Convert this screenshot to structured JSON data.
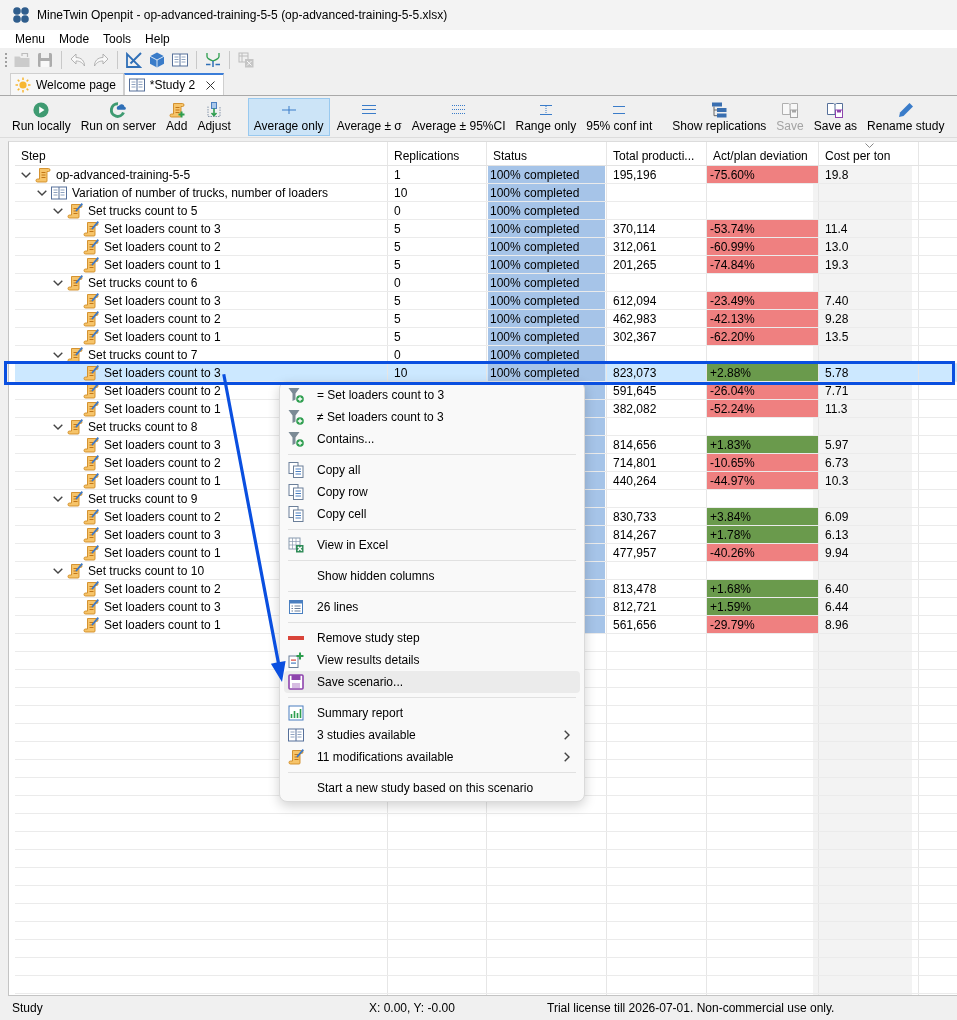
{
  "window": {
    "title": "MineTwin Openpit - op-advanced-training-5-5 (op-advanced-training-5-5.xlsx)"
  },
  "menu_bar": [
    "Menu",
    "Mode",
    "Tools",
    "Help"
  ],
  "icon_toolbar": [
    [
      {
        "kind": "open",
        "disabled": true
      },
      {
        "kind": "save",
        "disabled": true
      }
    ],
    [
      {
        "kind": "undo",
        "disabled": true
      },
      {
        "kind": "redo",
        "disabled": true
      }
    ],
    [
      {
        "kind": "edit",
        "disabled": false
      },
      {
        "kind": "model",
        "disabled": false
      },
      {
        "kind": "study",
        "disabled": false
      }
    ],
    [
      {
        "kind": "merge",
        "disabled": false
      }
    ],
    [
      {
        "kind": "export",
        "disabled": true
      }
    ]
  ],
  "tabs": [
    {
      "label": "Welcome page",
      "kind": "welcome",
      "selected": false,
      "closable": false
    },
    {
      "label": "*Study 2",
      "kind": "study",
      "selected": true,
      "closable": true
    }
  ],
  "study_toolbar": {
    "actions": [
      {
        "label": "Run locally",
        "kind": "run",
        "disabled": false
      },
      {
        "label": "Run on server",
        "kind": "server",
        "disabled": false
      },
      {
        "label": "Add",
        "kind": "add",
        "disabled": false
      },
      {
        "label": "Adjust",
        "kind": "adjust",
        "disabled": false
      }
    ],
    "display_modes": [
      {
        "label": "Average only",
        "kind": "mean",
        "selected": true
      },
      {
        "label": "Average ± σ",
        "kind": "sigma",
        "selected": false
      },
      {
        "label": "Average ± 95%CI",
        "kind": "ci",
        "selected": false
      },
      {
        "label": "Range only",
        "kind": "range",
        "selected": false
      },
      {
        "label": "95% conf int",
        "kind": "conf",
        "selected": false
      }
    ],
    "view_actions": [
      {
        "label": "Show replications",
        "kind": "tree",
        "disabled": false
      },
      {
        "label": "Save",
        "kind": "save",
        "disabled": true
      },
      {
        "label": "Save as",
        "kind": "saveas",
        "disabled": false
      },
      {
        "label": "Rename study",
        "kind": "rename",
        "disabled": false
      }
    ]
  },
  "table": {
    "columns": [
      {
        "label": "Step",
        "sorted": false
      },
      {
        "label": "Replications",
        "sorted": false
      },
      {
        "label": "Status",
        "sorted": false
      },
      {
        "label": "Total producti...",
        "sorted": false
      },
      {
        "label": "Act/plan deviation",
        "sorted": false
      },
      {
        "label": "Cost per ton",
        "sorted": true
      }
    ],
    "rows": [
      {
        "label": "op-advanced-training-5-5",
        "kind": "scenario",
        "selected": false,
        "expanded": true,
        "replications": "1",
        "status": {
          "text": "100% completed",
          "level": 1
        },
        "total_production": "195,196",
        "deviation": {
          "text": "-75.60%",
          "color": "#ef8080"
        },
        "cost": "19.8",
        "children": [
          {
            "label": "Variation of number of trucks, number of loaders",
            "kind": "study",
            "selected": false,
            "expanded": true,
            "replications": "10",
            "status": {
              "text": "100% completed",
              "level": 1
            },
            "children": [
              {
                "label": "Set trucks count to 5",
                "kind": "modification",
                "selected": false,
                "expanded": true,
                "replications": "0",
                "status": {
                  "text": "100% completed",
                  "level": 1
                },
                "children": [
                  {
                    "label": "Set loaders count to 3",
                    "kind": "modification",
                    "selected": false,
                    "replications": "5",
                    "status": {
                      "text": "100% completed",
                      "level": 1
                    },
                    "total_production": "370,114",
                    "deviation": {
                      "text": "-53.74%",
                      "color": "#ef8080"
                    },
                    "cost": "11.4"
                  },
                  {
                    "label": "Set loaders count to 2",
                    "kind": "modification",
                    "selected": false,
                    "replications": "5",
                    "status": {
                      "text": "100% completed",
                      "level": 1
                    },
                    "total_production": "312,061",
                    "deviation": {
                      "text": "-60.99%",
                      "color": "#ef8080"
                    },
                    "cost": "13.0"
                  },
                  {
                    "label": "Set loaders count to 1",
                    "kind": "modification",
                    "selected": false,
                    "replications": "5",
                    "status": {
                      "text": "100% completed",
                      "level": 1
                    },
                    "total_production": "201,265",
                    "deviation": {
                      "text": "-74.84%",
                      "color": "#ef8080"
                    },
                    "cost": "19.3"
                  }
                ]
              },
              {
                "label": "Set trucks count to 6",
                "kind": "modification",
                "selected": false,
                "expanded": true,
                "replications": "0",
                "status": {
                  "text": "100% completed",
                  "level": 1
                },
                "children": [
                  {
                    "label": "Set loaders count to 3",
                    "kind": "modification",
                    "selected": false,
                    "replications": "5",
                    "status": {
                      "text": "100% completed",
                      "level": 1
                    },
                    "total_production": "612,094",
                    "deviation": {
                      "text": "-23.49%",
                      "color": "#ef8080"
                    },
                    "cost": "7.40"
                  },
                  {
                    "label": "Set loaders count to 2",
                    "kind": "modification",
                    "selected": false,
                    "replications": "5",
                    "status": {
                      "text": "100% completed",
                      "level": 1
                    },
                    "total_production": "462,983",
                    "deviation": {
                      "text": "-42.13%",
                      "color": "#ef8080"
                    },
                    "cost": "9.28"
                  },
                  {
                    "label": "Set loaders count to 1",
                    "kind": "modification",
                    "selected": false,
                    "replications": "5",
                    "status": {
                      "text": "100% completed",
                      "level": 1
                    },
                    "total_production": "302,367",
                    "deviation": {
                      "text": "-62.20%",
                      "color": "#ef8080"
                    },
                    "cost": "13.5"
                  }
                ]
              },
              {
                "label": "Set trucks count to 7",
                "kind": "modification",
                "selected": false,
                "expanded": true,
                "replications": "0",
                "status": {
                  "text": "100% completed",
                  "level": 1
                },
                "children": [
                  {
                    "label": "Set loaders count to 3",
                    "kind": "modification",
                    "selected": true,
                    "replications": "10",
                    "status": {
                      "text": "100% completed",
                      "level": 1
                    },
                    "total_production": "823,073",
                    "deviation": {
                      "text": "+2.88%",
                      "color": "#6a9a4c"
                    },
                    "cost": "5.78"
                  },
                  {
                    "label": "Set loaders count to 2",
                    "kind": "modification",
                    "selected": false,
                    "status": {
                      "level": 1
                    },
                    "total_production": "591,645",
                    "deviation": {
                      "text": "-26.04%",
                      "color": "#ef8080"
                    },
                    "cost": "7.71"
                  },
                  {
                    "label": "Set loaders count to 1",
                    "kind": "modification",
                    "selected": false,
                    "status": {
                      "level": 1
                    },
                    "total_production": "382,082",
                    "deviation": {
                      "text": "-52.24%",
                      "color": "#ef8080"
                    },
                    "cost": "11.3"
                  }
                ]
              },
              {
                "label": "Set trucks count to 8",
                "kind": "modification",
                "selected": false,
                "expanded": true,
                "status": {
                  "level": 1
                },
                "children": [
                  {
                    "label": "Set loaders count to 3",
                    "kind": "modification",
                    "selected": false,
                    "status": {
                      "level": 1
                    },
                    "total_production": "814,656",
                    "deviation": {
                      "text": "+1.83%",
                      "color": "#6a9a4c"
                    },
                    "cost": "5.97"
                  },
                  {
                    "label": "Set loaders count to 2",
                    "kind": "modification",
                    "selected": false,
                    "status": {
                      "level": 1
                    },
                    "total_production": "714,801",
                    "deviation": {
                      "text": "-10.65%",
                      "color": "#ef8080"
                    },
                    "cost": "6.73"
                  },
                  {
                    "label": "Set loaders count to 1",
                    "kind": "modification",
                    "selected": false,
                    "status": {
                      "level": 1
                    },
                    "total_production": "440,264",
                    "deviation": {
                      "text": "-44.97%",
                      "color": "#ef8080"
                    },
                    "cost": "10.3"
                  }
                ]
              },
              {
                "label": "Set trucks count to 9",
                "kind": "modification",
                "selected": false,
                "expanded": true,
                "status": {
                  "level": 1
                },
                "children": [
                  {
                    "label": "Set loaders count to 2",
                    "kind": "modification",
                    "selected": false,
                    "status": {
                      "level": 1
                    },
                    "total_production": "830,733",
                    "deviation": {
                      "text": "+3.84%",
                      "color": "#6a9a4c"
                    },
                    "cost": "6.09"
                  },
                  {
                    "label": "Set loaders count to 3",
                    "kind": "modification",
                    "selected": false,
                    "status": {
                      "level": 1
                    },
                    "total_production": "814,267",
                    "deviation": {
                      "text": "+1.78%",
                      "color": "#6a9a4c"
                    },
                    "cost": "6.13"
                  },
                  {
                    "label": "Set loaders count to 1",
                    "kind": "modification",
                    "selected": false,
                    "status": {
                      "level": 1
                    },
                    "total_production": "477,957",
                    "deviation": {
                      "text": "-40.26%",
                      "color": "#ef8080"
                    },
                    "cost": "9.94"
                  }
                ]
              },
              {
                "label": "Set trucks count to 10",
                "kind": "modification",
                "selected": false,
                "expanded": true,
                "status": {
                  "level": 1
                },
                "children": [
                  {
                    "label": "Set loaders count to 2",
                    "kind": "modification",
                    "selected": false,
                    "status": {
                      "level": 1
                    },
                    "total_production": "813,478",
                    "deviation": {
                      "text": "+1.68%",
                      "color": "#6a9a4c"
                    },
                    "cost": "6.40"
                  },
                  {
                    "label": "Set loaders count to 3",
                    "kind": "modification",
                    "selected": false,
                    "status": {
                      "level": 1
                    },
                    "total_production": "812,721",
                    "deviation": {
                      "text": "+1.59%",
                      "color": "#6a9a4c"
                    },
                    "cost": "6.44"
                  },
                  {
                    "label": "Set loaders count to 1",
                    "kind": "modification",
                    "selected": false,
                    "status": {
                      "level": 1
                    },
                    "total_production": "561,656",
                    "deviation": {
                      "text": "-29.79%",
                      "color": "#ef8080"
                    },
                    "cost": "8.96"
                  }
                ]
              }
            ]
          }
        ]
      }
    ]
  },
  "context_menu": {
    "sections": [
      [
        {
          "label": "= Set loaders count to 3",
          "kind": "filter",
          "highlighted": false,
          "submenu": false
        },
        {
          "label": "≠ Set loaders count to 3",
          "kind": "filter",
          "highlighted": false,
          "submenu": false
        },
        {
          "label": "Contains...",
          "kind": "filter",
          "highlighted": false,
          "submenu": false
        }
      ],
      [
        {
          "label": "Copy all",
          "kind": "copy",
          "highlighted": false,
          "submenu": false
        },
        {
          "label": "Copy row",
          "kind": "copy",
          "highlighted": false,
          "submenu": false
        },
        {
          "label": "Copy cell",
          "kind": "copy",
          "highlighted": false,
          "submenu": false
        }
      ],
      [
        {
          "label": "View in Excel",
          "kind": "spreadsheet",
          "highlighted": false,
          "submenu": false
        }
      ],
      [
        {
          "label": "Show hidden columns",
          "kind": "none",
          "highlighted": false,
          "submenu": false
        }
      ],
      [
        {
          "label": "26 lines",
          "kind": "list",
          "highlighted": false,
          "submenu": false
        }
      ],
      [
        {
          "label": "Remove study step",
          "kind": "remove",
          "highlighted": false,
          "submenu": false
        },
        {
          "label": "View results details",
          "kind": "details",
          "highlighted": false,
          "submenu": false
        },
        {
          "label": "Save scenario...",
          "kind": "save",
          "highlighted": true,
          "submenu": false
        }
      ],
      [
        {
          "label": "Summary report",
          "kind": "report",
          "highlighted": false,
          "submenu": false
        },
        {
          "label": "3 studies available",
          "kind": "book",
          "highlighted": false,
          "submenu": true
        },
        {
          "label": "11 modifications available",
          "kind": "scroll",
          "highlighted": false,
          "submenu": true
        }
      ],
      [
        {
          "label": "Start a new study based on this scenario",
          "kind": "none",
          "highlighted": false,
          "submenu": false
        }
      ]
    ]
  },
  "annotation": {
    "row_frame": true,
    "arrow": true
  },
  "status_bar": {
    "mode": "Study",
    "coordinates": "X: 0.00, Y: -0.00",
    "license": "Trial license till 2026-07-01. Non-commercial use only."
  }
}
